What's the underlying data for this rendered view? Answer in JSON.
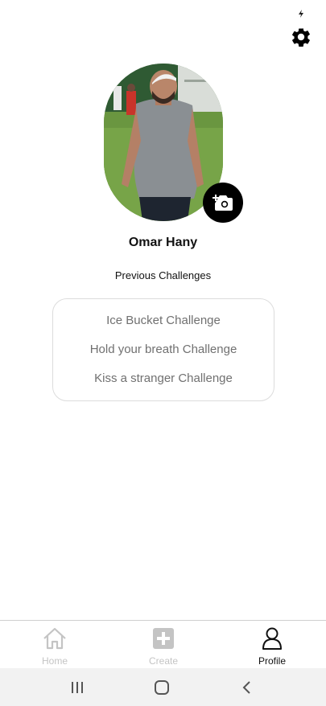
{
  "profile": {
    "name": "Omar Hany",
    "previous_challenges_title": "Previous Challenges",
    "challenges": [
      "Ice Bucket Challenge",
      "Hold your breath Challenge",
      "Kiss a stranger Challenge"
    ]
  },
  "bottom_nav": {
    "items": [
      {
        "label": "Home",
        "icon": "home-icon",
        "active": false
      },
      {
        "label": "Create",
        "icon": "plus-square-icon",
        "active": false
      },
      {
        "label": "Profile",
        "icon": "user-icon",
        "active": true
      }
    ]
  },
  "icons": {
    "settings": "gear-icon",
    "change_photo": "camera-add-icon",
    "status": "charging-bolt-icon",
    "system_nav": [
      "recents-icon",
      "home-circle-icon",
      "back-chevron-icon"
    ]
  },
  "colors": {
    "active": "#111111",
    "inactive": "#c4c4c4",
    "card_border": "#dcdcdc",
    "challenge_text": "#707070"
  }
}
